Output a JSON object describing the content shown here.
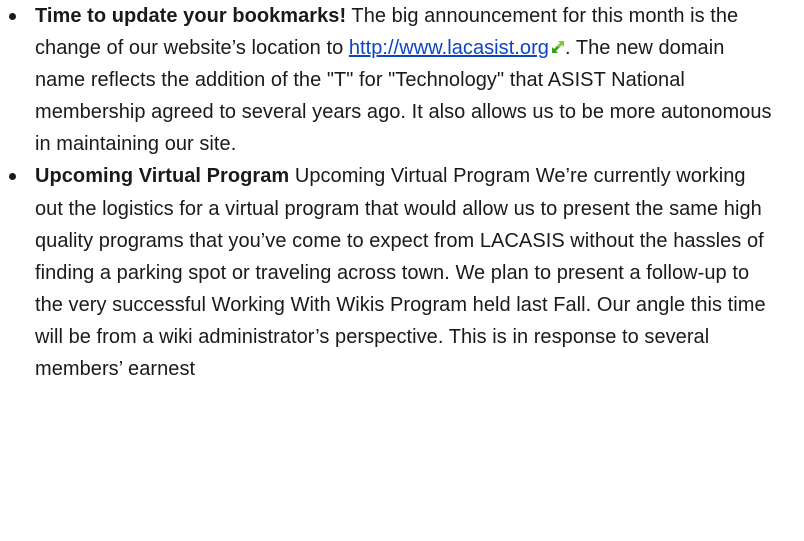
{
  "items": [
    {
      "title": "Time to update your bookmarks!",
      "text_before_link": " The big announcement for this month is the change of our website’s location to ",
      "link_text": "http://www.lacasist.org",
      "text_after_link": ". The new domain name reflects the addition of the \"T\" for \"Technology\" that ASIST National membership agreed to several years ago. It also allows us to be more autonomous in maintaining our site."
    },
    {
      "title": "Upcoming Virtual Program",
      "body": " Upcoming Virtual Program We’re currently working out the logistics for a virtual program that would allow us to present the same high quality programs that you’ve come to expect from LACASIS without the hassles of finding a parking spot or traveling across town. We plan to present a follow-up to the very successful Working With Wikis Program held last Fall. Our angle this time will be from a wiki administrator’s perspective. This is in response to several members’ earnest"
    }
  ],
  "colors": {
    "text": "#1a1a1a",
    "link": "#0b44c4",
    "external_icon": "#3a9a1a"
  },
  "icons": {
    "external_link": "external-link-icon"
  }
}
